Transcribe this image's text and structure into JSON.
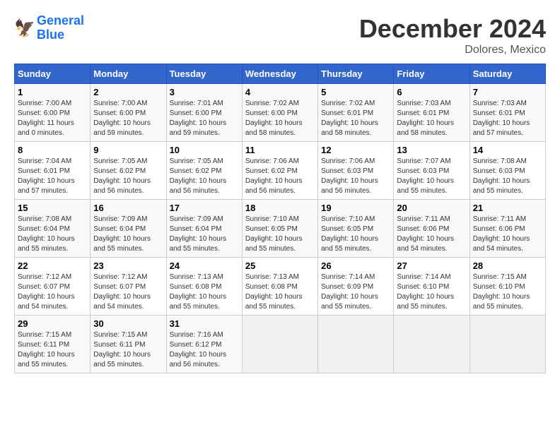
{
  "logo": {
    "line1": "General",
    "line2": "Blue"
  },
  "title": "December 2024",
  "location": "Dolores, Mexico",
  "weekdays": [
    "Sunday",
    "Monday",
    "Tuesday",
    "Wednesday",
    "Thursday",
    "Friday",
    "Saturday"
  ],
  "weeks": [
    [
      {
        "day": "1",
        "sunrise": "7:00 AM",
        "sunset": "6:00 PM",
        "daylight": "11 hours and 0 minutes."
      },
      {
        "day": "2",
        "sunrise": "7:00 AM",
        "sunset": "6:00 PM",
        "daylight": "10 hours and 59 minutes."
      },
      {
        "day": "3",
        "sunrise": "7:01 AM",
        "sunset": "6:00 PM",
        "daylight": "10 hours and 59 minutes."
      },
      {
        "day": "4",
        "sunrise": "7:02 AM",
        "sunset": "6:00 PM",
        "daylight": "10 hours and 58 minutes."
      },
      {
        "day": "5",
        "sunrise": "7:02 AM",
        "sunset": "6:01 PM",
        "daylight": "10 hours and 58 minutes."
      },
      {
        "day": "6",
        "sunrise": "7:03 AM",
        "sunset": "6:01 PM",
        "daylight": "10 hours and 58 minutes."
      },
      {
        "day": "7",
        "sunrise": "7:03 AM",
        "sunset": "6:01 PM",
        "daylight": "10 hours and 57 minutes."
      }
    ],
    [
      {
        "day": "8",
        "sunrise": "7:04 AM",
        "sunset": "6:01 PM",
        "daylight": "10 hours and 57 minutes."
      },
      {
        "day": "9",
        "sunrise": "7:05 AM",
        "sunset": "6:02 PM",
        "daylight": "10 hours and 56 minutes."
      },
      {
        "day": "10",
        "sunrise": "7:05 AM",
        "sunset": "6:02 PM",
        "daylight": "10 hours and 56 minutes."
      },
      {
        "day": "11",
        "sunrise": "7:06 AM",
        "sunset": "6:02 PM",
        "daylight": "10 hours and 56 minutes."
      },
      {
        "day": "12",
        "sunrise": "7:06 AM",
        "sunset": "6:03 PM",
        "daylight": "10 hours and 56 minutes."
      },
      {
        "day": "13",
        "sunrise": "7:07 AM",
        "sunset": "6:03 PM",
        "daylight": "10 hours and 55 minutes."
      },
      {
        "day": "14",
        "sunrise": "7:08 AM",
        "sunset": "6:03 PM",
        "daylight": "10 hours and 55 minutes."
      }
    ],
    [
      {
        "day": "15",
        "sunrise": "7:08 AM",
        "sunset": "6:04 PM",
        "daylight": "10 hours and 55 minutes."
      },
      {
        "day": "16",
        "sunrise": "7:09 AM",
        "sunset": "6:04 PM",
        "daylight": "10 hours and 55 minutes."
      },
      {
        "day": "17",
        "sunrise": "7:09 AM",
        "sunset": "6:04 PM",
        "daylight": "10 hours and 55 minutes."
      },
      {
        "day": "18",
        "sunrise": "7:10 AM",
        "sunset": "6:05 PM",
        "daylight": "10 hours and 55 minutes."
      },
      {
        "day": "19",
        "sunrise": "7:10 AM",
        "sunset": "6:05 PM",
        "daylight": "10 hours and 55 minutes."
      },
      {
        "day": "20",
        "sunrise": "7:11 AM",
        "sunset": "6:06 PM",
        "daylight": "10 hours and 54 minutes."
      },
      {
        "day": "21",
        "sunrise": "7:11 AM",
        "sunset": "6:06 PM",
        "daylight": "10 hours and 54 minutes."
      }
    ],
    [
      {
        "day": "22",
        "sunrise": "7:12 AM",
        "sunset": "6:07 PM",
        "daylight": "10 hours and 54 minutes."
      },
      {
        "day": "23",
        "sunrise": "7:12 AM",
        "sunset": "6:07 PM",
        "daylight": "10 hours and 54 minutes."
      },
      {
        "day": "24",
        "sunrise": "7:13 AM",
        "sunset": "6:08 PM",
        "daylight": "10 hours and 55 minutes."
      },
      {
        "day": "25",
        "sunrise": "7:13 AM",
        "sunset": "6:08 PM",
        "daylight": "10 hours and 55 minutes."
      },
      {
        "day": "26",
        "sunrise": "7:14 AM",
        "sunset": "6:09 PM",
        "daylight": "10 hours and 55 minutes."
      },
      {
        "day": "27",
        "sunrise": "7:14 AM",
        "sunset": "6:10 PM",
        "daylight": "10 hours and 55 minutes."
      },
      {
        "day": "28",
        "sunrise": "7:15 AM",
        "sunset": "6:10 PM",
        "daylight": "10 hours and 55 minutes."
      }
    ],
    [
      {
        "day": "29",
        "sunrise": "7:15 AM",
        "sunset": "6:11 PM",
        "daylight": "10 hours and 55 minutes."
      },
      {
        "day": "30",
        "sunrise": "7:15 AM",
        "sunset": "6:11 PM",
        "daylight": "10 hours and 55 minutes."
      },
      {
        "day": "31",
        "sunrise": "7:16 AM",
        "sunset": "6:12 PM",
        "daylight": "10 hours and 56 minutes."
      },
      null,
      null,
      null,
      null
    ]
  ],
  "labels": {
    "sunrise": "Sunrise:",
    "sunset": "Sunset:",
    "daylight": "Daylight:"
  }
}
